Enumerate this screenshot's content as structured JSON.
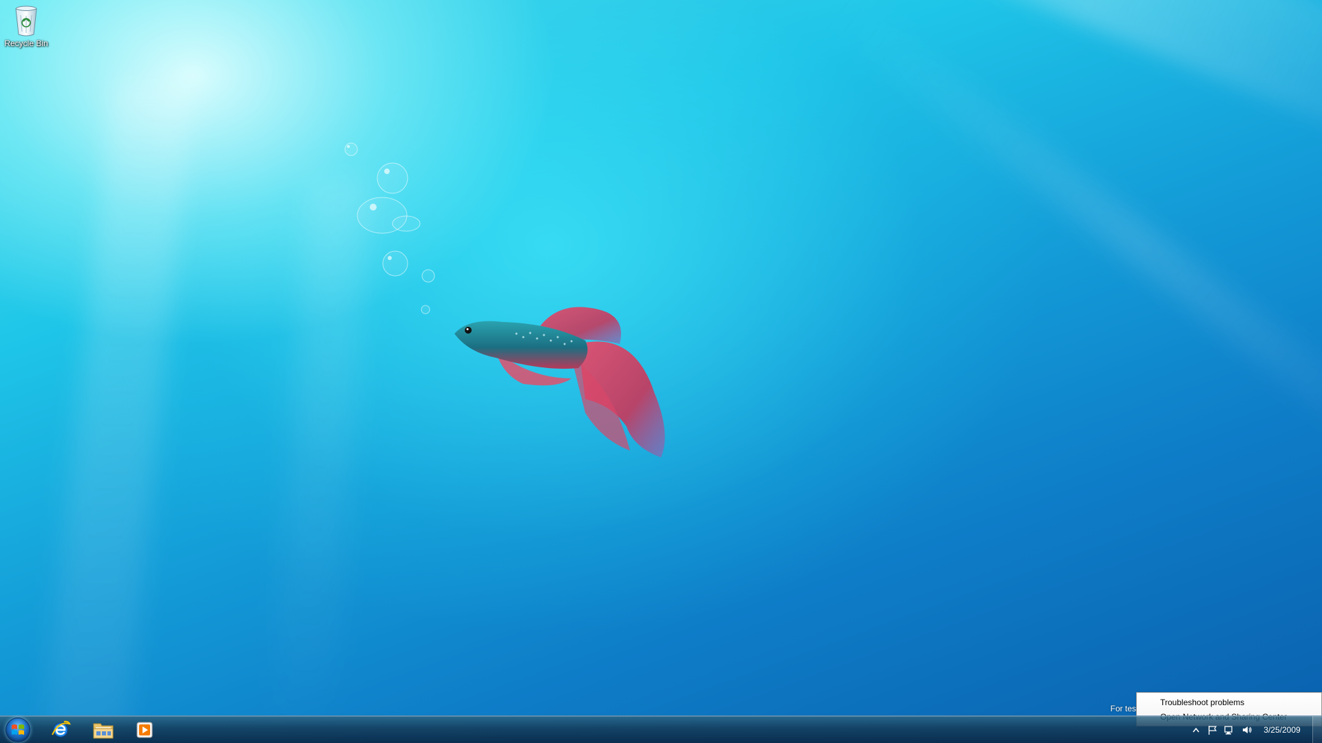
{
  "desktop": {
    "icons": [
      {
        "label": "Recycle Bin",
        "icon": "recycle-bin-icon"
      }
    ],
    "watermark": "For testi"
  },
  "context_menu": {
    "items": [
      {
        "label": "Troubleshoot problems"
      },
      {
        "label": "Open Network and Sharing Center"
      }
    ]
  },
  "taskbar": {
    "start_icon": "windows-logo-icon",
    "pinned": [
      {
        "name": "Internet Explorer",
        "icon": "internet-explorer-icon"
      },
      {
        "name": "Windows Explorer",
        "icon": "folder-icon"
      },
      {
        "name": "Windows Media Player",
        "icon": "media-player-icon"
      }
    ],
    "tray": {
      "icons": [
        "show-hidden-icons-arrow",
        "action-center-flag-icon",
        "network-icon",
        "volume-icon"
      ],
      "date": "3/25/2009"
    }
  },
  "colors": {
    "accent": "#1c6fc7",
    "wallpaper_light": "#54e3ee",
    "wallpaper_dark": "#0a5fac"
  }
}
